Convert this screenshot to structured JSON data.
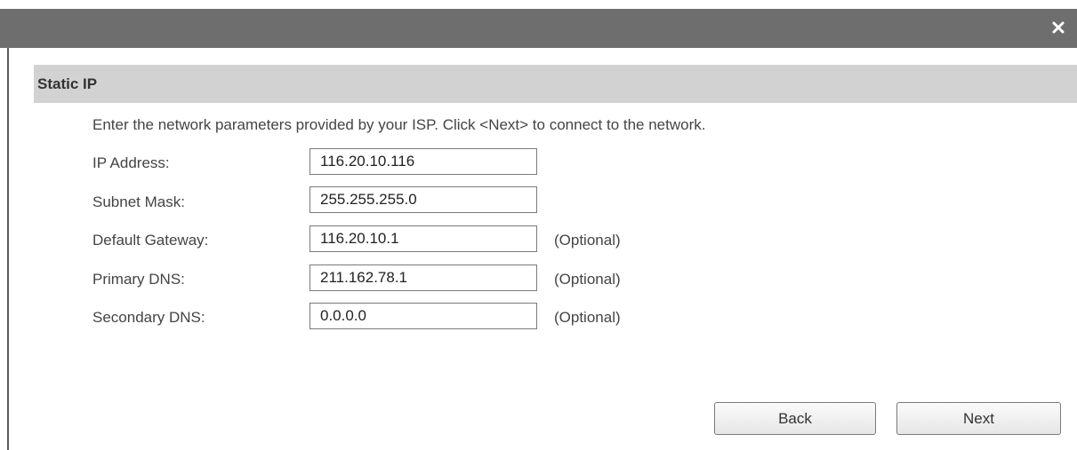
{
  "dialog": {
    "close_icon": "close-icon"
  },
  "section": {
    "title": "Static IP",
    "instructions": "Enter the network parameters provided by your ISP. Click <Next> to connect to the network."
  },
  "fields": [
    {
      "label": "IP Address:",
      "value": "116.20.10.116",
      "hint": ""
    },
    {
      "label": "Subnet Mask:",
      "value": "255.255.255.0",
      "hint": ""
    },
    {
      "label": "Default Gateway:",
      "value": "116.20.10.1",
      "hint": "(Optional)"
    },
    {
      "label": "Primary DNS:",
      "value": "211.162.78.1",
      "hint": "(Optional)"
    },
    {
      "label": "Secondary DNS:",
      "value": "0.0.0.0",
      "hint": "(Optional)"
    }
  ],
  "buttons": {
    "back_label": "Back",
    "next_label": "Next"
  },
  "colors": {
    "title_bar": "#6e6e6e",
    "section_header": "#d2d2d2"
  }
}
